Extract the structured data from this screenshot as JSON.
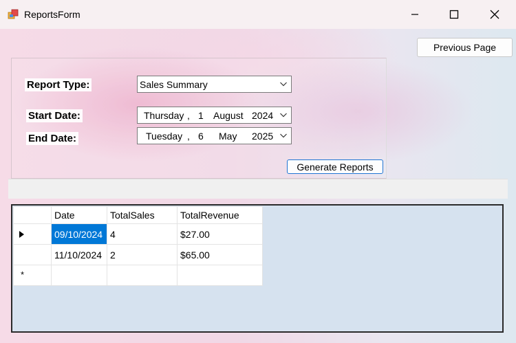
{
  "window": {
    "title": "ReportsForm",
    "icon": "app-form-icon"
  },
  "toolbar": {
    "previous_label": "Previous Page"
  },
  "form": {
    "report_type_label": "Report Type:",
    "report_type_value": "Sales Summary",
    "start_date_label": "Start Date:",
    "start_date": {
      "weekday": "Thursday",
      "sep": ",",
      "day": "1",
      "month": "August",
      "year": "2024"
    },
    "end_date_label": "End Date:",
    "end_date": {
      "weekday": "Tuesday",
      "sep": ",",
      "day": "6",
      "month": "May",
      "year": "2025"
    },
    "generate_label": "Generate Reports"
  },
  "grid": {
    "columns": [
      "Date",
      "TotalSales",
      "TotalRevenue"
    ],
    "rows": [
      [
        "09/10/2024",
        "4",
        "$27.00"
      ],
      [
        "11/10/2024",
        "2",
        "$65.00"
      ]
    ],
    "new_row_marker": "*"
  },
  "colors": {
    "selection": "#0078d7",
    "grid_background": "#d6e2ef",
    "button_focus_border": "#1f74d3"
  }
}
